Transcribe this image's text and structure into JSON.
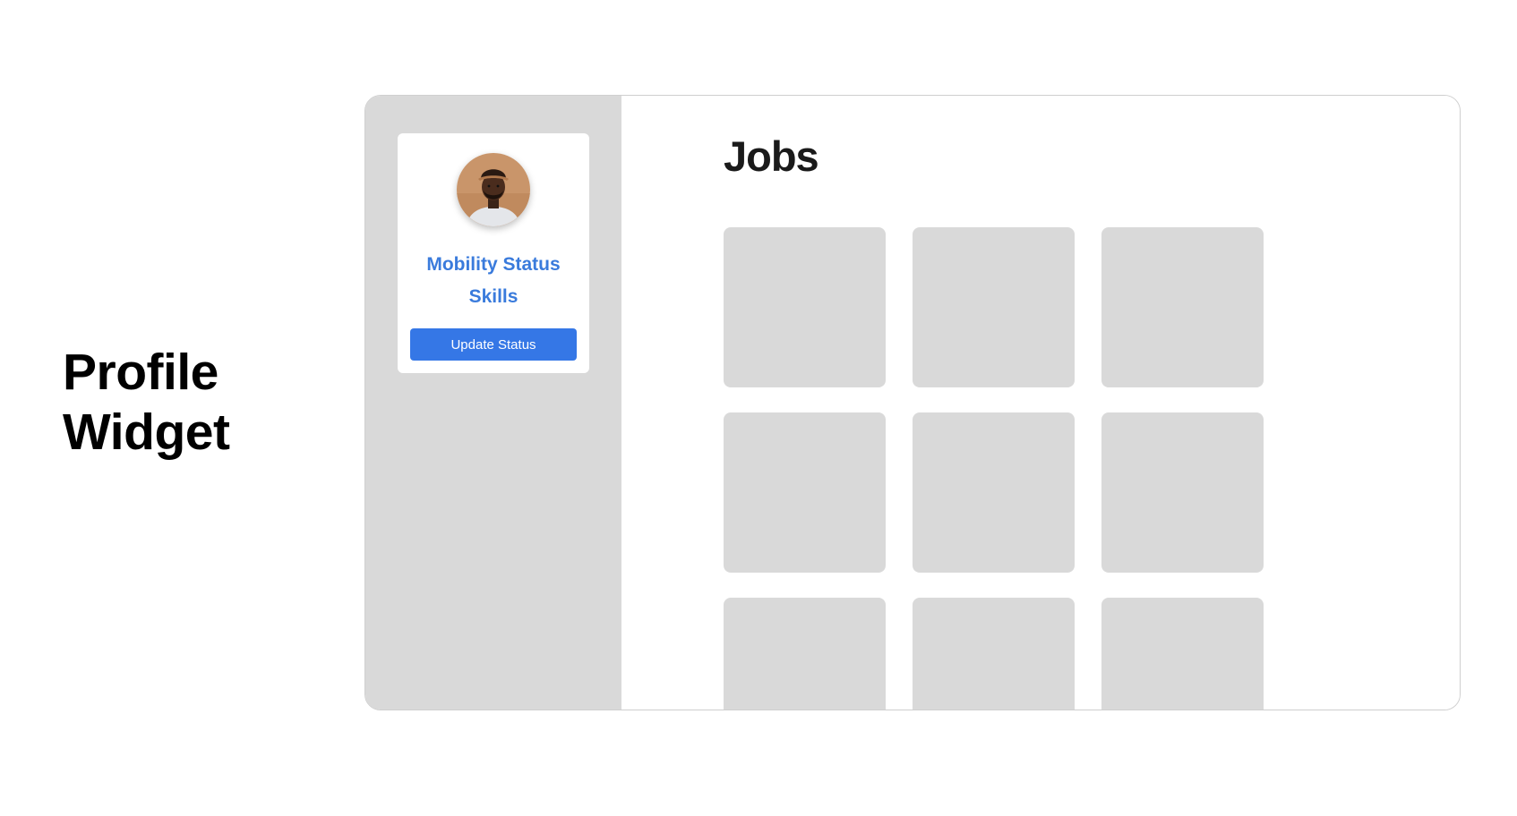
{
  "side_title": {
    "line1": "Profile",
    "line2": "Widget"
  },
  "profile": {
    "avatar_icon": "user-photo-avatar",
    "mobility_status_label": "Mobility Status",
    "skills_label": "Skills",
    "update_button_label": "Update Status"
  },
  "main": {
    "title": "Jobs",
    "job_cards": [
      {
        "id": 1
      },
      {
        "id": 2
      },
      {
        "id": 3
      },
      {
        "id": 4
      },
      {
        "id": 5
      },
      {
        "id": 6
      },
      {
        "id": 7
      },
      {
        "id": 8
      },
      {
        "id": 9
      }
    ]
  },
  "colors": {
    "accent": "#3577e6",
    "link": "#3a7bdc",
    "sidebar_bg": "#d9d9d9",
    "placeholder": "#d9d9d9"
  }
}
